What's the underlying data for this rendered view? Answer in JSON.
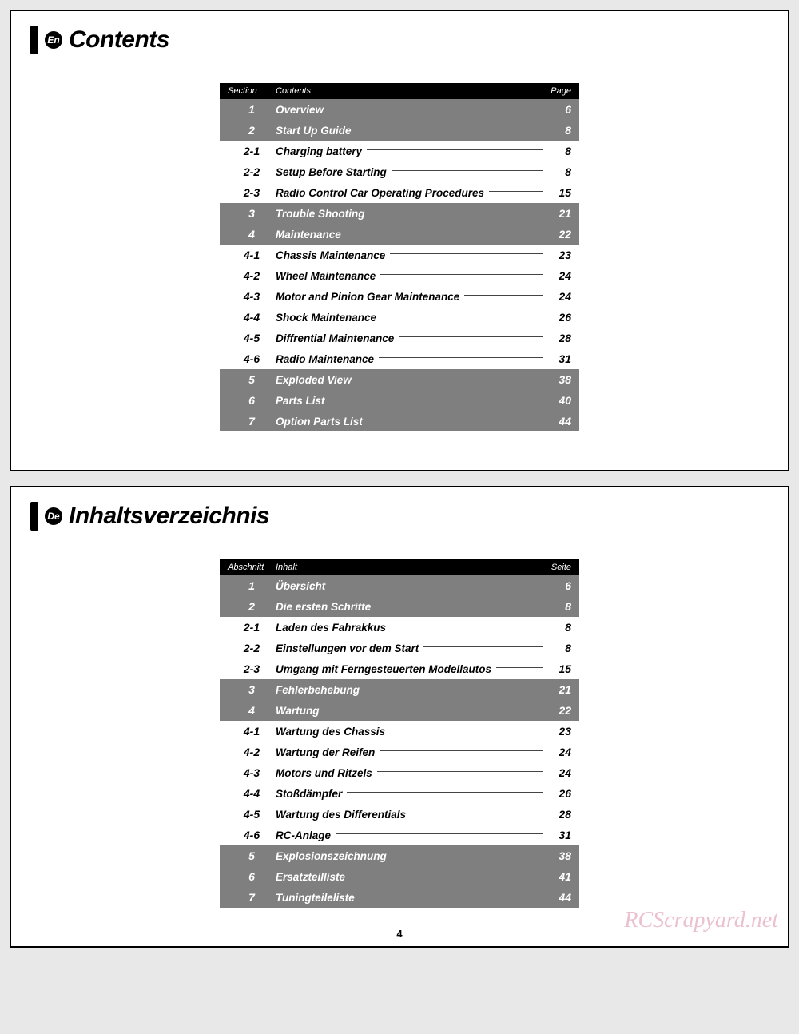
{
  "page_number": "4",
  "watermark": "RCScrapyard.net",
  "sections": [
    {
      "lang_badge": "En",
      "title": "Contents",
      "headers": {
        "section": "Section",
        "contents": "Contents",
        "page": "Page"
      },
      "rows": [
        {
          "section": "1",
          "title": "Overview",
          "page": "6",
          "shaded": true
        },
        {
          "section": "2",
          "title": "Start Up Guide",
          "page": "8",
          "shaded": true
        },
        {
          "section": "2-1",
          "title": "Charging battery",
          "page": "8",
          "shaded": false
        },
        {
          "section": "2-2",
          "title": "Setup Before Starting",
          "page": "8",
          "shaded": false
        },
        {
          "section": "2-3",
          "title": "Radio Control Car Operating Procedures",
          "page": "15",
          "shaded": false
        },
        {
          "section": "3",
          "title": "Trouble Shooting",
          "page": "21",
          "shaded": true
        },
        {
          "section": "4",
          "title": "Maintenance",
          "page": "22",
          "shaded": true
        },
        {
          "section": "4-1",
          "title": "Chassis Maintenance",
          "page": "23",
          "shaded": false
        },
        {
          "section": "4-2",
          "title": "Wheel Maintenance",
          "page": "24",
          "shaded": false
        },
        {
          "section": "4-3",
          "title": "Motor and Pinion Gear Maintenance",
          "page": "24",
          "shaded": false
        },
        {
          "section": "4-4",
          "title": "Shock Maintenance",
          "page": "26",
          "shaded": false
        },
        {
          "section": "4-5",
          "title": "Diffrential Maintenance",
          "page": "28",
          "shaded": false
        },
        {
          "section": "4-6",
          "title": "Radio Maintenance",
          "page": "31",
          "shaded": false
        },
        {
          "section": "5",
          "title": "Exploded View",
          "page": "38",
          "shaded": true
        },
        {
          "section": "6",
          "title": "Parts List",
          "page": "40",
          "shaded": true
        },
        {
          "section": "7",
          "title": "Option Parts List",
          "page": "44",
          "shaded": true
        }
      ]
    },
    {
      "lang_badge": "De",
      "title": "Inhaltsverzeichnis",
      "headers": {
        "section": "Abschnitt",
        "contents": "Inhalt",
        "page": "Seite"
      },
      "rows": [
        {
          "section": "1",
          "title": "Übersicht",
          "page": "6",
          "shaded": true
        },
        {
          "section": "2",
          "title": "Die ersten Schritte",
          "page": "8",
          "shaded": true
        },
        {
          "section": "2-1",
          "title": "Laden des Fahrakkus",
          "page": "8",
          "shaded": false
        },
        {
          "section": "2-2",
          "title": "Einstellungen vor dem Start",
          "page": "8",
          "shaded": false
        },
        {
          "section": "2-3",
          "title": "Umgang mit Ferngesteuerten Modellautos",
          "page": "15",
          "shaded": false
        },
        {
          "section": "3",
          "title": "Fehlerbehebung",
          "page": "21",
          "shaded": true
        },
        {
          "section": "4",
          "title": "Wartung",
          "page": "22",
          "shaded": true
        },
        {
          "section": "4-1",
          "title": "Wartung des Chassis",
          "page": "23",
          "shaded": false
        },
        {
          "section": "4-2",
          "title": "Wartung der Reifen",
          "page": "24",
          "shaded": false
        },
        {
          "section": "4-3",
          "title": "Motors und Ritzels",
          "page": "24",
          "shaded": false
        },
        {
          "section": "4-4",
          "title": "Stoßdämpfer",
          "page": "26",
          "shaded": false
        },
        {
          "section": "4-5",
          "title": "Wartung des Differentials",
          "page": "28",
          "shaded": false
        },
        {
          "section": "4-6",
          "title": "RC-Anlage",
          "page": "31",
          "shaded": false
        },
        {
          "section": "5",
          "title": "Explosionszeichnung",
          "page": "38",
          "shaded": true
        },
        {
          "section": "6",
          "title": "Ersatzteilliste",
          "page": "41",
          "shaded": true
        },
        {
          "section": "7",
          "title": "Tuningteileliste",
          "page": "44",
          "shaded": true
        }
      ]
    }
  ]
}
